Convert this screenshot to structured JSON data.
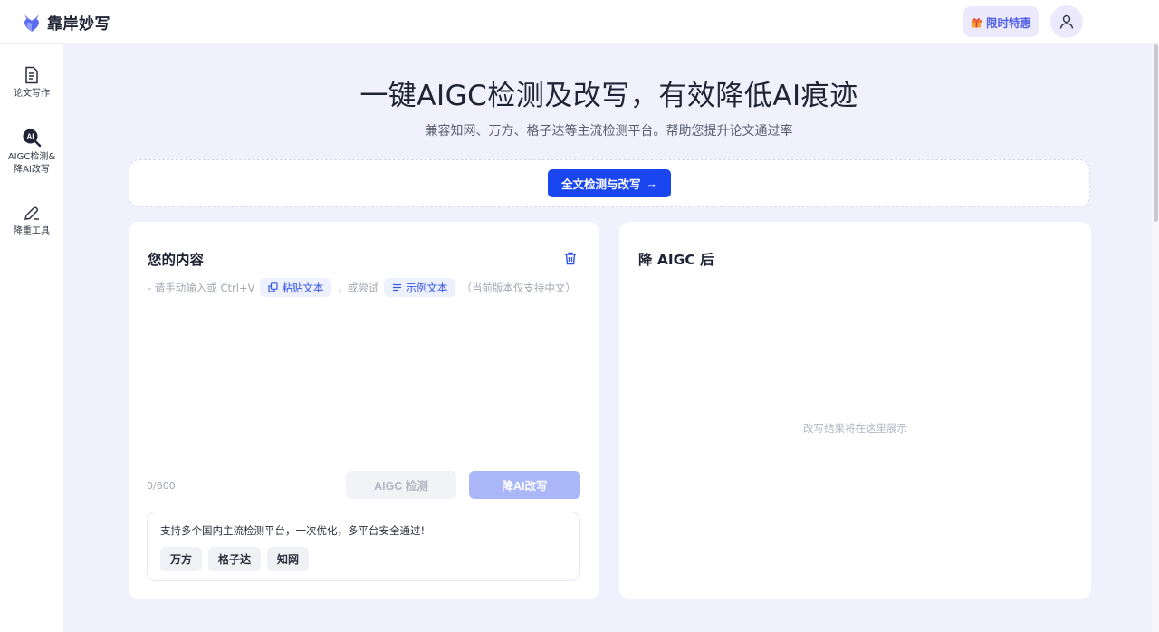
{
  "brand": {
    "name": "靠岸妙写",
    "logo_icon": "fox-heart-logo"
  },
  "header": {
    "promo_label": "限时特惠",
    "promo_icon": "gift-icon",
    "avatar_icon": "user-icon"
  },
  "sidebar": {
    "items": [
      {
        "label": "论文写作",
        "icon": "document-icon"
      },
      {
        "label_line1": "AIGC检测&",
        "label_line2": "降AI改写",
        "icon": "ai-search-icon"
      },
      {
        "label": "降重工具",
        "icon": "pen-icon"
      }
    ]
  },
  "hero": {
    "title": "一键AIGC检测及改写，有效降低AI痕迹",
    "subtitle": "兼容知网、万方、格子达等主流检测平台。帮助您提升论文通过率",
    "cta_label": "全文检测与改写",
    "cta_arrow": "→"
  },
  "input_panel": {
    "title": "您的内容",
    "hint_prefix": "- 请手动输入或 Ctrl+V",
    "paste_label": "粘贴文本",
    "hint_or": "，或尝试",
    "sample_label": "示例文本",
    "hint_note": "（当前版本仅支持中文）",
    "counter": "0/600",
    "detect_label": "AIGC 检测",
    "rewrite_label": "降AI改写",
    "support_text": "支持多个国内主流检测平台，一次优化，多平台安全通过!",
    "platforms": [
      "万方",
      "格子达",
      "知网"
    ]
  },
  "output_panel": {
    "title": "降 AIGC 后",
    "placeholder": "改写结果将在这里展示"
  },
  "colors": {
    "accent": "#1a46f0",
    "page_bg": "#f1f1fd",
    "chip_text": "#3554e8",
    "rewrite_disabled": "#a9b6f8"
  }
}
